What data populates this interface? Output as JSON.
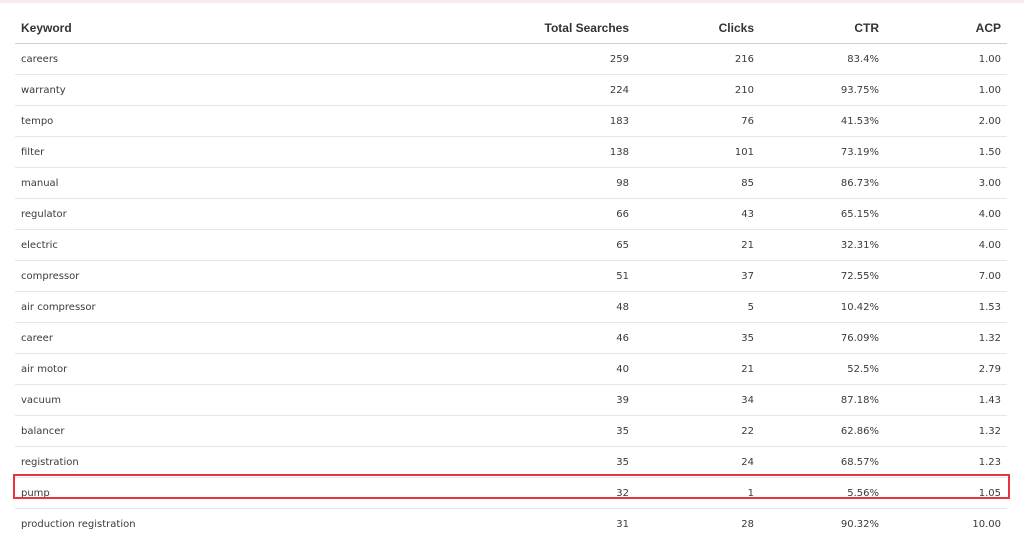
{
  "table": {
    "headers": {
      "keyword": "Keyword",
      "total_searches": "Total Searches",
      "clicks": "Clicks",
      "ctr": "CTR",
      "acp": "ACP"
    },
    "rows": [
      {
        "keyword": "careers",
        "total_searches": "259",
        "clicks": "216",
        "ctr": "83.4%",
        "acp": "1.00"
      },
      {
        "keyword": "warranty",
        "total_searches": "224",
        "clicks": "210",
        "ctr": "93.75%",
        "acp": "1.00"
      },
      {
        "keyword": "tempo",
        "total_searches": "183",
        "clicks": "76",
        "ctr": "41.53%",
        "acp": "2.00"
      },
      {
        "keyword": "filter",
        "total_searches": "138",
        "clicks": "101",
        "ctr": "73.19%",
        "acp": "1.50"
      },
      {
        "keyword": "manual",
        "total_searches": "98",
        "clicks": "85",
        "ctr": "86.73%",
        "acp": "3.00"
      },
      {
        "keyword": "regulator",
        "total_searches": "66",
        "clicks": "43",
        "ctr": "65.15%",
        "acp": "4.00"
      },
      {
        "keyword": "electric",
        "total_searches": "65",
        "clicks": "21",
        "ctr": "32.31%",
        "acp": "4.00"
      },
      {
        "keyword": "compressor",
        "total_searches": "51",
        "clicks": "37",
        "ctr": "72.55%",
        "acp": "7.00"
      },
      {
        "keyword": "air compressor",
        "total_searches": "48",
        "clicks": "5",
        "ctr": "10.42%",
        "acp": "1.53"
      },
      {
        "keyword": "career",
        "total_searches": "46",
        "clicks": "35",
        "ctr": "76.09%",
        "acp": "1.32"
      },
      {
        "keyword": "air motor",
        "total_searches": "40",
        "clicks": "21",
        "ctr": "52.5%",
        "acp": "2.79"
      },
      {
        "keyword": "vacuum",
        "total_searches": "39",
        "clicks": "34",
        "ctr": "87.18%",
        "acp": "1.43"
      },
      {
        "keyword": "balancer",
        "total_searches": "35",
        "clicks": "22",
        "ctr": "62.86%",
        "acp": "1.32"
      },
      {
        "keyword": "registration",
        "total_searches": "35",
        "clicks": "24",
        "ctr": "68.57%",
        "acp": "1.23"
      },
      {
        "keyword": "pump",
        "total_searches": "32",
        "clicks": "1",
        "ctr": "5.56%",
        "acp": "1.05"
      },
      {
        "keyword": "production registration",
        "total_searches": "31",
        "clicks": "28",
        "ctr": "90.32%",
        "acp": "10.00"
      }
    ]
  },
  "highlight": {
    "color": "#e8343f"
  }
}
